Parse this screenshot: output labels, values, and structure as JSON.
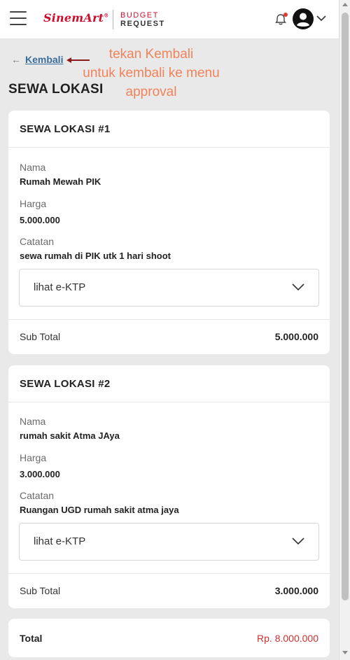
{
  "header": {
    "logo_text": "SinemArt",
    "logo_sup": "®",
    "budget_line1": "BUDGET",
    "budget_line2": "REQUEST"
  },
  "back": {
    "arrow": "←",
    "label": "Kembali"
  },
  "annotation": {
    "line1": "tekan Kembali",
    "line2": "untuk kembali ke menu",
    "line3": "approval"
  },
  "page_title": "SEWA LOKASI",
  "cards": [
    {
      "title": "SEWA LOKASI #1",
      "nama_label": "Nama",
      "nama_value": "Rumah Mewah PIK",
      "harga_label": "Harga",
      "harga_value": "5.000.000",
      "catatan_label": "Catatan",
      "catatan_value": "sewa rumah di PIK utk 1 hari shoot",
      "dropdown_label": "lihat e-KTP",
      "subtotal_label": "Sub Total",
      "subtotal_value": "5.000.000"
    },
    {
      "title": "SEWA LOKASI #2",
      "nama_label": "Nama",
      "nama_value": "rumah sakit Atma JAya",
      "harga_label": "Harga",
      "harga_value": "3.000.000",
      "catatan_label": "Catatan",
      "catatan_value": "Ruangan UGD rumah sakit atma jaya",
      "dropdown_label": "lihat e-KTP",
      "subtotal_label": "Sub Total",
      "subtotal_value": "3.000.000"
    }
  ],
  "total": {
    "label": "Total",
    "value": "Rp. 8.000.000"
  },
  "colors": {
    "brand": "#c8102e",
    "annotation": "#f0835a",
    "total_value": "#d32f2f",
    "link": "#3b6e9a"
  }
}
